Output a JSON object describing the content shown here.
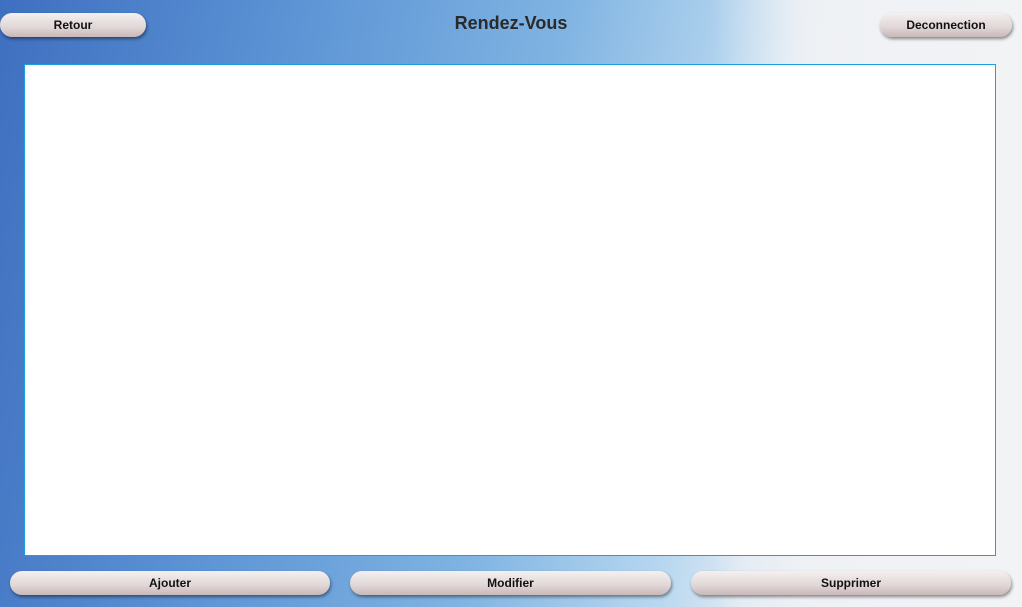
{
  "header": {
    "title": "Rendez-Vous",
    "back_label": "Retour",
    "logout_label": "Deconnection"
  },
  "actions": {
    "add_label": "Ajouter",
    "edit_label": "Modifier",
    "delete_label": "Supprimer"
  },
  "colors": {
    "panel_border": "#1aa0e0"
  }
}
